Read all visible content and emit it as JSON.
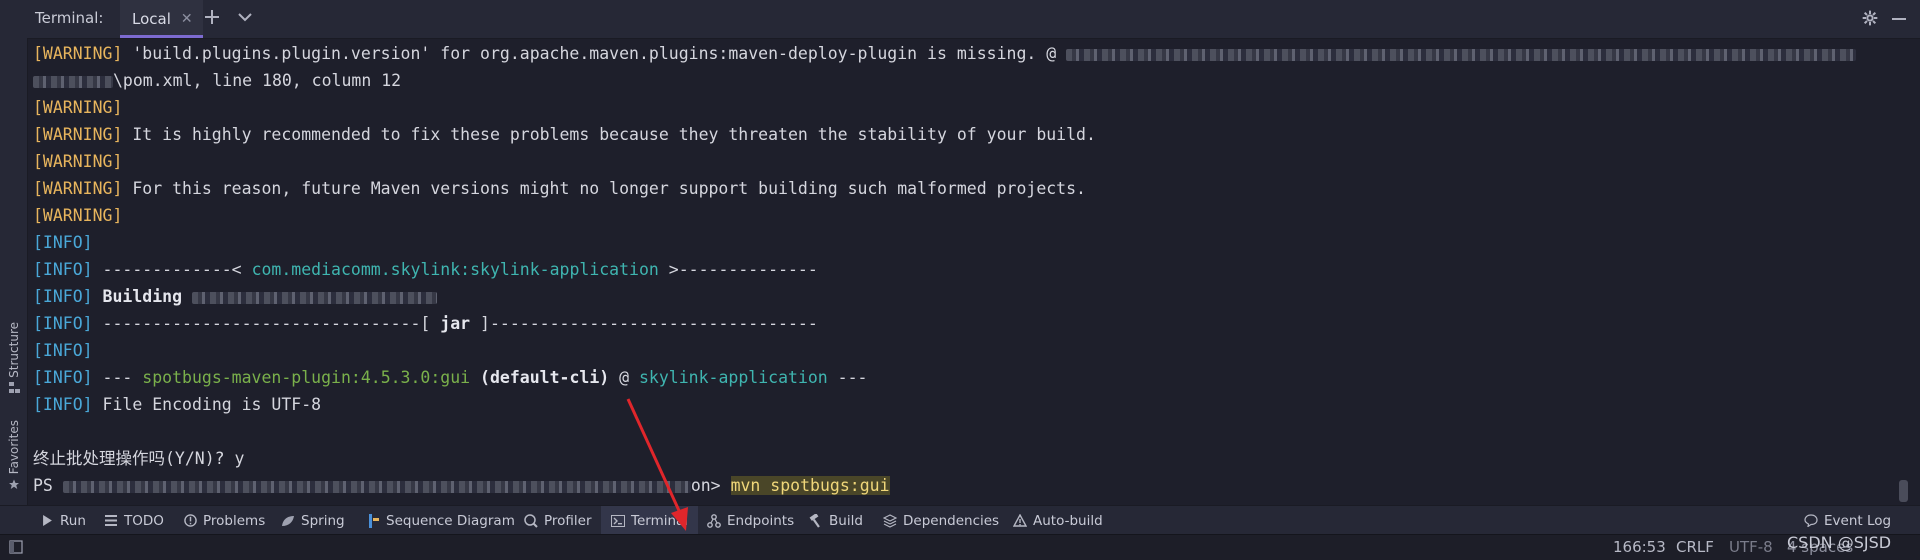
{
  "header": {
    "title": "Terminal:",
    "tab_label": "Local",
    "add_tooltip": "+"
  },
  "side_tabs": {
    "structure": "Structure",
    "favorites": "Favorites"
  },
  "terminal": {
    "warn_tag": "[WARNING]",
    "info_tag": "[INFO]",
    "l1_text": " 'build.plugins.plugin.version' for org.apache.maven.plugins:maven-deploy-plugin is missing. @",
    "l2_text": "\\pom.xml, line 180, column 12",
    "l4_text": " It is highly recommended to fix these problems because they threaten the stability of your build.",
    "l6_text": " For this reason, future Maven versions might no longer support building such malformed projects.",
    "l9_pre": " -------------< ",
    "l9_artifact": "com.mediacomm.skylink:skylink-application",
    "l9_post": " >--------------",
    "l10_text": "Building",
    "l11_pre": " --------------------------------[ ",
    "l11_mid": "jar",
    "l11_post": " ]---------------------------------",
    "l13_pre": " --- ",
    "l13_plugin": "spotbugs-maven-plugin:4.5.3.0:gui",
    "l13_cli": "(default-cli)",
    "l13_at": " @ ",
    "l13_proj": "skylink-application",
    "l13_post": " ---",
    "l14_text": " File Encoding is UTF-8",
    "batch_prompt": "终止批处理操作吗(Y/N)? y",
    "ps_label": "PS",
    "ps_suffix": "on> ",
    "command": "mvn spotbugs:gui"
  },
  "toolbar": {
    "run": "Run",
    "todo": "TODO",
    "problems": "Problems",
    "spring": "Spring",
    "sequence": "Sequence Diagram",
    "profiler": "Profiler",
    "terminal": "Terminal",
    "endpoints": "Endpoints",
    "build": "Build",
    "dependencies": "Dependencies",
    "autobuild": "Auto-build",
    "eventlog": "Event Log"
  },
  "status": {
    "position": "166:53",
    "line_sep": "CRLF",
    "encoding": "UTF-8",
    "indent": "4 spaces",
    "watermark": "CSDN @SJSD"
  },
  "colors": {
    "background": "#1e1f2b",
    "warning": "#e8b55d",
    "info": "#4aa8d8",
    "accent": "#7d6bd0",
    "arrow": "#e0262b"
  }
}
